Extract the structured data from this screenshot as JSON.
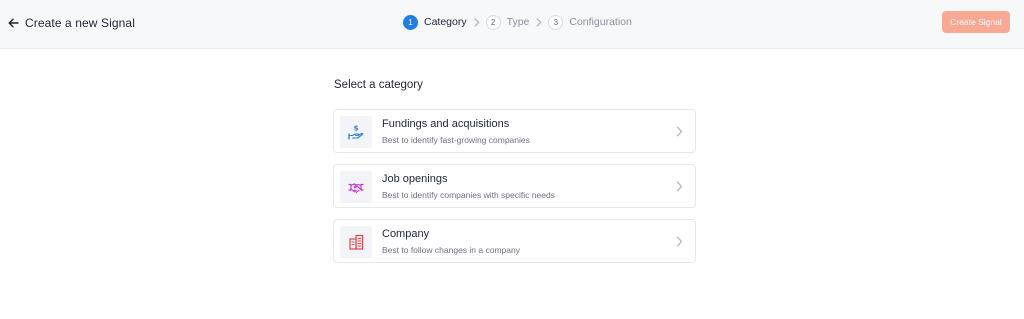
{
  "header": {
    "back_label": "Create a new Signal",
    "steps": [
      {
        "number": "1",
        "label": "Category",
        "active": true
      },
      {
        "number": "2",
        "label": "Type",
        "active": false
      },
      {
        "number": "3",
        "label": "Configuration",
        "active": false
      }
    ],
    "create_button_label": "Create Signal"
  },
  "main": {
    "section_title": "Select a category",
    "categories": [
      {
        "title": "Fundings and acquisitions",
        "description": "Best to identify fast-growing companies",
        "icon": "money-hand-icon",
        "icon_color": "#2f7fd6"
      },
      {
        "title": "Job openings",
        "description": "Best to identify companies with specific needs",
        "icon": "handshake-icon",
        "icon_color": "#c03ad6"
      },
      {
        "title": "Company",
        "description": "Best to follow changes in a company",
        "icon": "buildings-icon",
        "icon_color": "#e2464b"
      }
    ]
  },
  "colors": {
    "accent": "#1f7ee8",
    "create_button": "#f8a994",
    "header_bg": "#f7f8fa"
  }
}
